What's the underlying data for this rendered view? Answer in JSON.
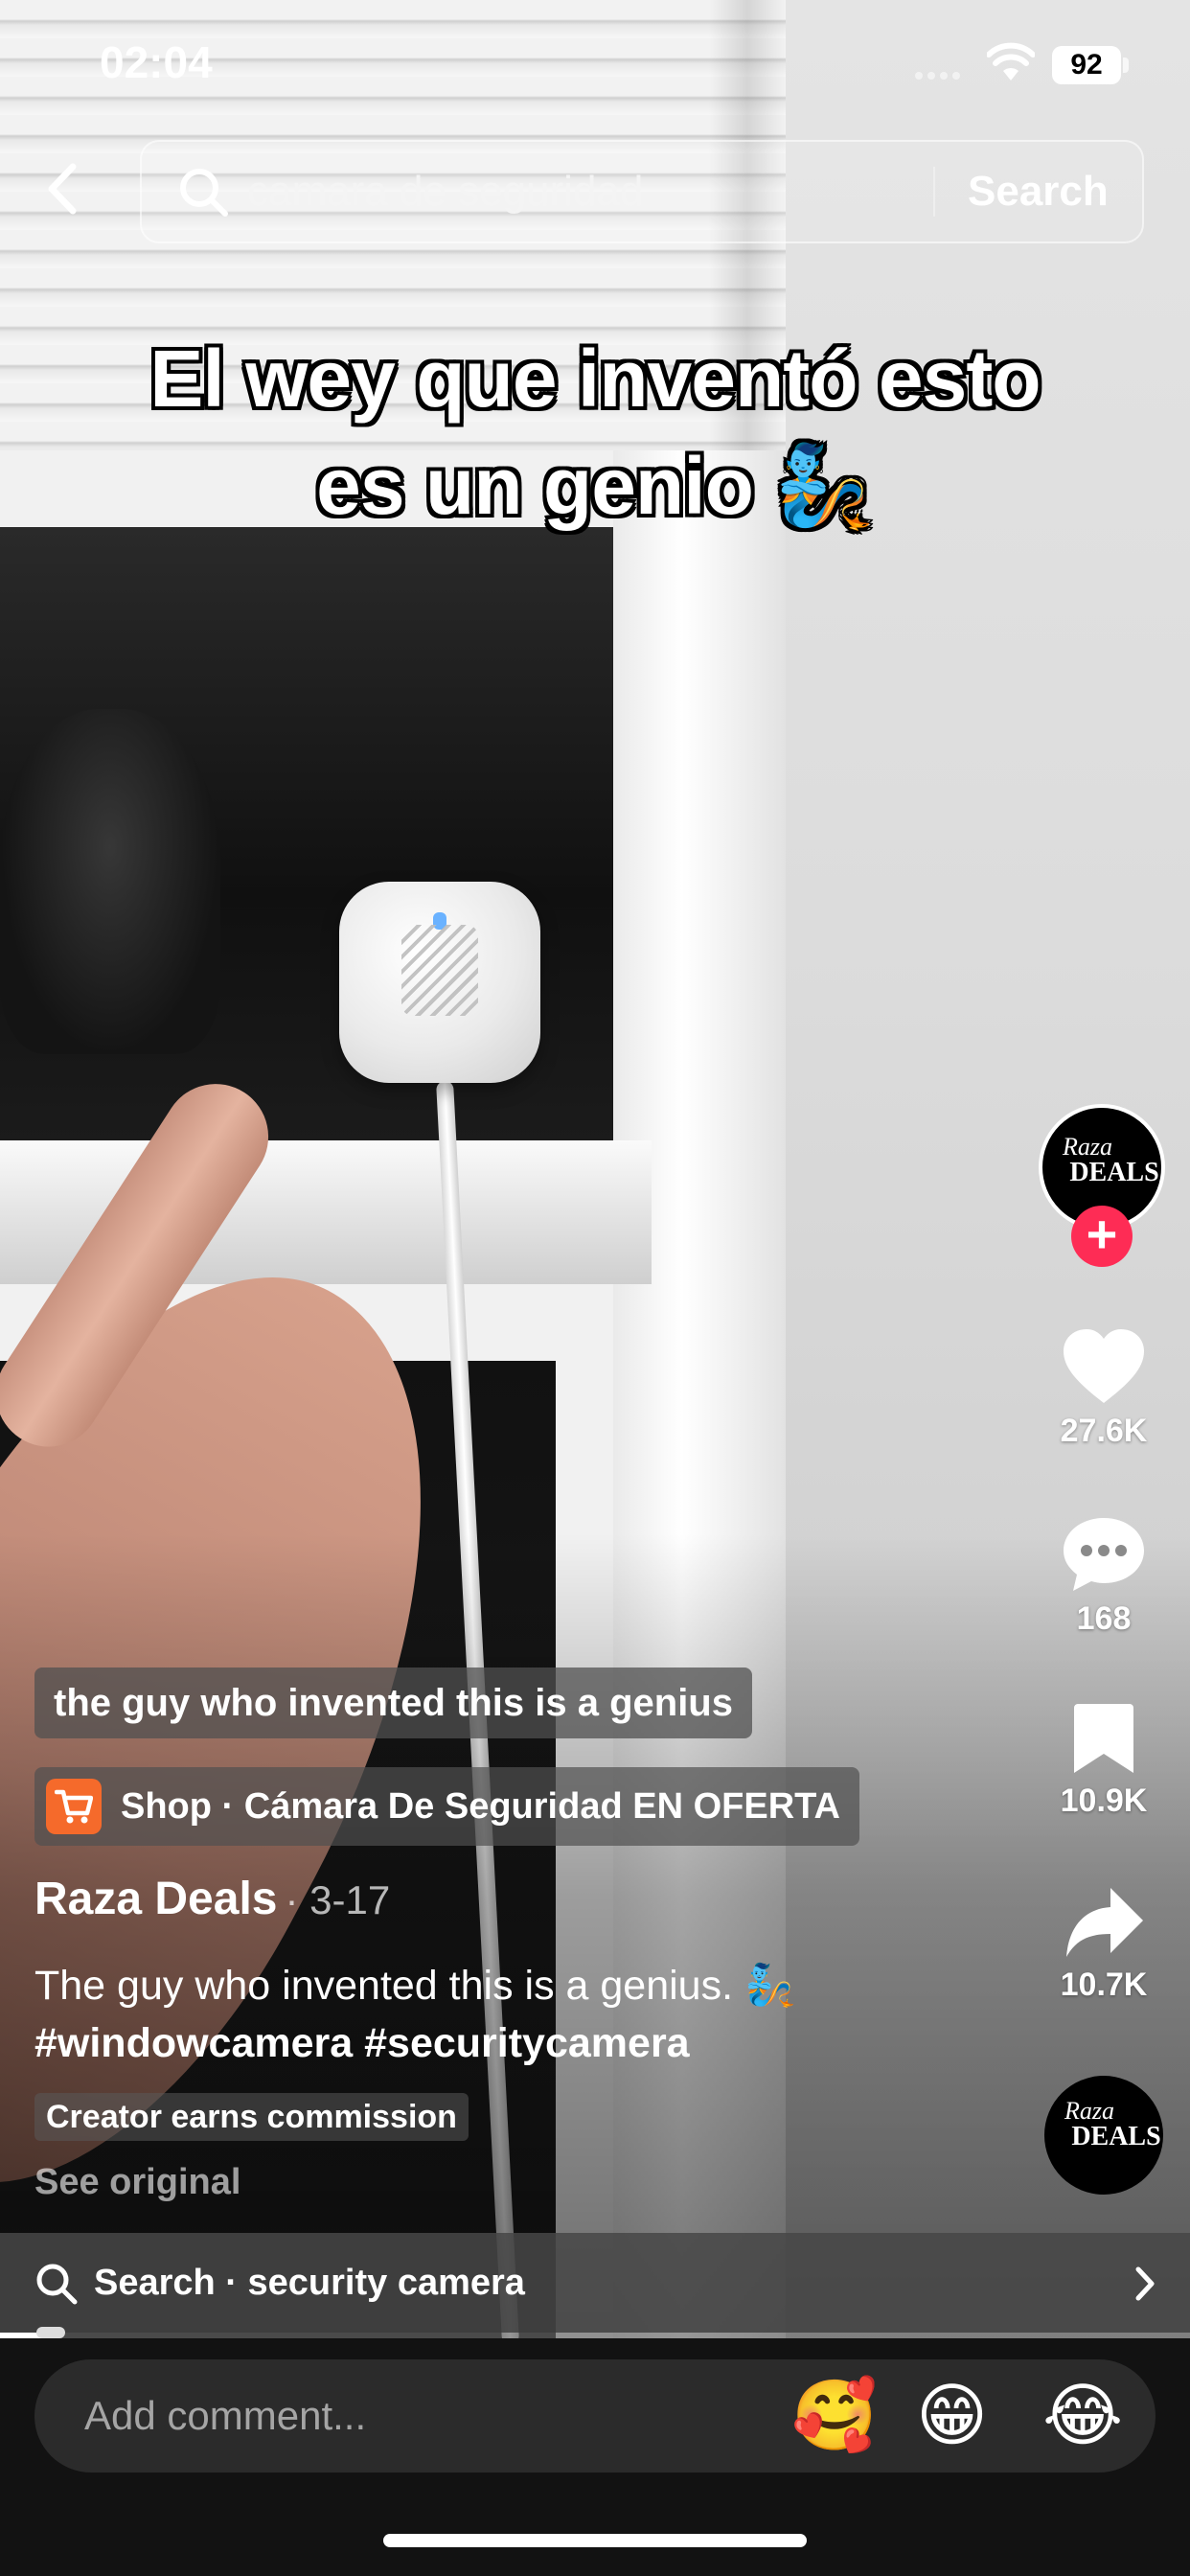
{
  "status_bar": {
    "time": "02:04",
    "battery": "92"
  },
  "search": {
    "query": "camara de seguridad",
    "button_label": "Search"
  },
  "video": {
    "caption_line1": "El wey que inventó esto",
    "caption_line2": "es un genio 🧞"
  },
  "rail": {
    "avatar_text1": "Raza",
    "avatar_text2": "DEALS",
    "follow_symbol": "+",
    "likes": "27.6K",
    "comments": "168",
    "saves": "10.9K",
    "shares": "10.7K"
  },
  "info": {
    "translation": "the guy who invented this is a genius",
    "shop_label": "Shop · Cámara De Seguridad EN OFERTA",
    "author": "Raza Deals",
    "date": "· 3-17",
    "description": "The guy who invented this is a genius. 🧞",
    "hashtags": "#windowcamera #securitycamera",
    "commission_badge": "Creator earns commission",
    "see_original": "See original"
  },
  "related_search": {
    "label": "Search · security camera"
  },
  "playback": {
    "progress_fraction": 0.04
  },
  "comment_bar": {
    "placeholder": "Add comment...",
    "emojis": [
      "🥰",
      "😁",
      "😂"
    ]
  },
  "colors": {
    "accent_follow": "#fe2c55",
    "shop_orange": "#f56a2b"
  },
  "icons": [
    "back-chevron-icon",
    "search-icon",
    "heart-icon",
    "comment-icon",
    "bookmark-icon",
    "share-icon",
    "shopping-cart-icon",
    "chevron-right-icon",
    "wifi-icon"
  ]
}
